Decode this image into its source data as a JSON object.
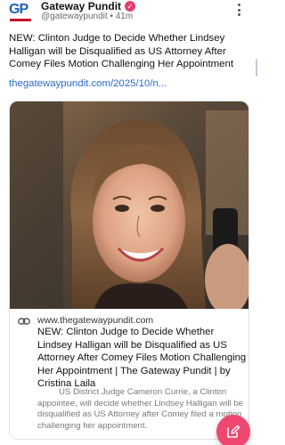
{
  "post": {
    "author": "Gateway Pundit",
    "logo_text_g": "G",
    "logo_text_p": "P",
    "handle": "@gatewaypundit",
    "separator": "•",
    "time": "41m",
    "text": "NEW: Clinton Judge to Decide Whether Lindsey Halligan will be Disqualified as US Attorney After Comey Files Motion Challenging Her Appointment",
    "link": "thegatewaypundit.com/2025/10/n..."
  },
  "card": {
    "domain": "www.thegatewaypundit.com",
    "title": "NEW: Clinton Judge to Decide Whether Lindsey Halligan will be Disqualified as US Attorney After Comey Files Motion Challenging Her Appointment | The Gateway Pundit | by Cristina Laila",
    "description": "US District Judge Cameron Currie, a Clinton appointee, will decide whether Lindsey Halligan will be disqualified as US Attorney after Comey filed a motion challenging her appointment."
  },
  "colors": {
    "accent": "#ef476f",
    "link": "#2a6acb",
    "brand_blue": "#1f5fb8",
    "brand_red": "#c8102e"
  },
  "icons": {
    "verified": "check-badge-icon",
    "more": "more-vertical-icon",
    "link": "link-icon",
    "compose": "compose-icon"
  }
}
